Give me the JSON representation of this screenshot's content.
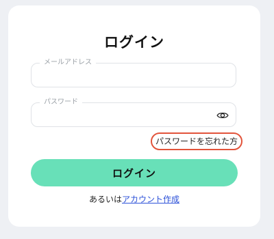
{
  "login_card": {
    "title": "ログイン",
    "email_field": {
      "label": "メールアドレス",
      "value": ""
    },
    "password_field": {
      "label": "パスワード",
      "value": "",
      "toggle_icon": "eye-icon"
    },
    "forgot_password_link": "パスワードを忘れた方",
    "login_button": "ログイン",
    "signup_prefix": "あるいは",
    "signup_link": "アカウント作成"
  },
  "colors": {
    "page_background": "#eef0f4",
    "card_background": "#ffffff",
    "button_fill": "#68e0b8",
    "highlight_outline": "#e2533a",
    "link": "#2b50d8"
  }
}
